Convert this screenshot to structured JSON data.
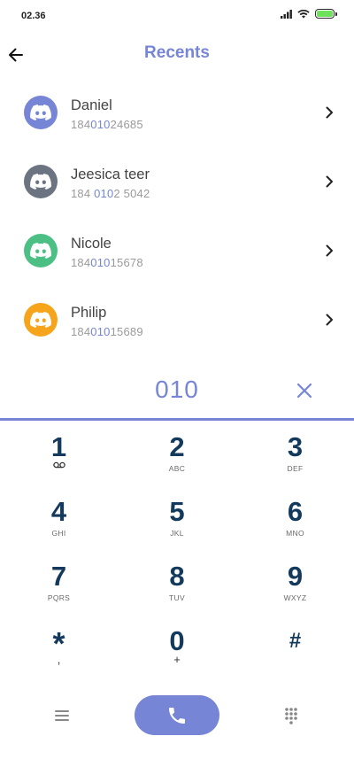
{
  "status_bar": {
    "time": "02.36"
  },
  "header": {
    "title": "Recents"
  },
  "recents": [
    {
      "name": "Daniel",
      "number_pre": "184",
      "number_match": "010",
      "number_post": "24685",
      "avatar_color": "#7685d5"
    },
    {
      "name": "Jeesica teer",
      "number_pre": "184 ",
      "number_match": "010",
      "number_post": "2 5042",
      "avatar_color": "#6b7480"
    },
    {
      "name": "Nicole",
      "number_pre": "184",
      "number_match": "010",
      "number_post": "15678",
      "avatar_color": "#4cc084"
    },
    {
      "name": "Philip",
      "number_pre": "184",
      "number_match": "010",
      "number_post": "15689",
      "avatar_color": "#f5a41c"
    }
  ],
  "dialer": {
    "dialed": "010"
  },
  "keypad": [
    {
      "digit": "1",
      "letters": "",
      "sub": "voicemail"
    },
    {
      "digit": "2",
      "letters": "ABC"
    },
    {
      "digit": "3",
      "letters": "DEF"
    },
    {
      "digit": "4",
      "letters": "GHI"
    },
    {
      "digit": "5",
      "letters": "JKL"
    },
    {
      "digit": "6",
      "letters": "MNO"
    },
    {
      "digit": "7",
      "letters": "PQRS"
    },
    {
      "digit": "8",
      "letters": "TUV"
    },
    {
      "digit": "9",
      "letters": "WXYZ"
    },
    {
      "digit": "*",
      "letters": ","
    },
    {
      "digit": "0",
      "letters": "+"
    },
    {
      "digit": "#",
      "letters": ""
    }
  ],
  "colors": {
    "accent": "#7685d5",
    "digit": "#133a5c",
    "battery": "#6fe05c"
  },
  "icons": {
    "back": "arrow-left-icon",
    "chevron": "chevron-right-icon",
    "clear": "close-icon",
    "call": "phone-icon",
    "menu": "hamburger-menu-icon",
    "dialpad": "dialpad-icon",
    "avatar": "discord-logo-icon"
  }
}
